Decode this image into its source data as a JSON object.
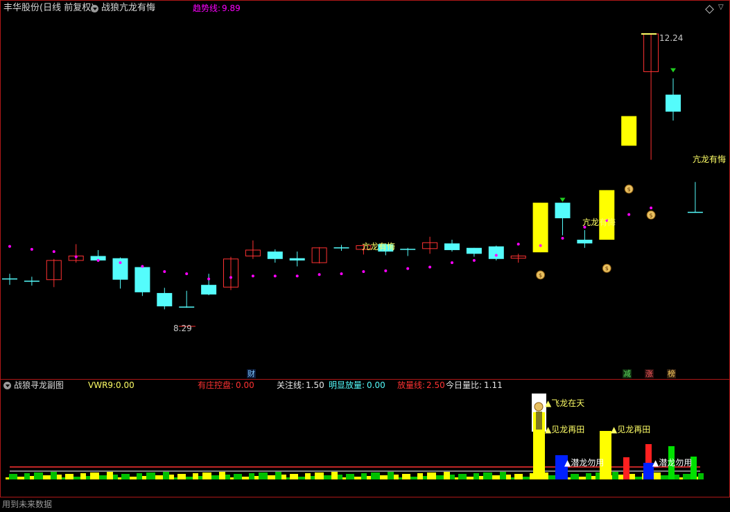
{
  "main_panel": {
    "title": "丰华股份(日线 前复权)",
    "indicator_name": "战狼亢龙有悔",
    "trend_label": "趋势线:",
    "trend_value": "9.89",
    "high_label": "12.24",
    "low_label": "8.29",
    "annotations": [
      "亢龙有悔",
      "亢龙有悔",
      "亢龙有悔"
    ],
    "bottom_markers": {
      "cai": "财",
      "jian": "减",
      "zhang": "涨",
      "bang": "榜"
    }
  },
  "sub_panel": {
    "title": "战狼寻龙副图",
    "vwr_label": "VWR9:",
    "vwr_value": "0.00",
    "youzhuang_label": "有庄控盘:",
    "youzhuang_value": "0.00",
    "guanzhu_label": "关注线:",
    "guanzhu_value": "1.50",
    "mingxian_label": "明显放量:",
    "mingxian_value": "0.00",
    "fangliang_label": "放量线:",
    "fangliang_value": "2.50",
    "jinri_label": "今日量比:",
    "jinri_value": "1.11",
    "signals": [
      "飞龙在天",
      "见龙再田",
      "见龙再田",
      "潜龙勿用",
      "潜龙勿用"
    ]
  },
  "footer": {
    "notice": "用到未来数据"
  },
  "colors": {
    "border": "#b01818",
    "bear": "#54fcfc",
    "bull": "#ff3232",
    "signal": "#ffff00",
    "trend": "#ff00ff"
  },
  "candles": [
    {
      "o": 8.93,
      "c": 8.93,
      "h": 9.0,
      "l": 8.85
    },
    {
      "o": 8.9,
      "c": 8.9,
      "h": 8.96,
      "l": 8.84
    },
    {
      "o": 8.92,
      "c": 9.18,
      "h": 9.2,
      "l": 8.82
    },
    {
      "o": 9.18,
      "c": 9.24,
      "h": 9.4,
      "l": 9.15
    },
    {
      "o": 9.24,
      "c": 9.18,
      "h": 9.32,
      "l": 9.16
    },
    {
      "o": 9.21,
      "c": 8.92,
      "h": 9.22,
      "l": 8.8
    },
    {
      "o": 9.09,
      "c": 8.75,
      "h": 9.1,
      "l": 8.7
    },
    {
      "o": 8.74,
      "c": 8.56,
      "h": 8.81,
      "l": 8.52
    },
    {
      "o": 8.55,
      "c": 8.55,
      "h": 8.77,
      "l": 8.54
    },
    {
      "o": 8.85,
      "c": 8.72,
      "h": 9.0,
      "l": 8.71
    },
    {
      "o": 8.82,
      "c": 9.2,
      "h": 9.23,
      "l": 8.78
    },
    {
      "o": 9.24,
      "c": 9.32,
      "h": 9.45,
      "l": 9.2
    },
    {
      "o": 9.3,
      "c": 9.2,
      "h": 9.33,
      "l": 9.15
    },
    {
      "o": 9.21,
      "c": 9.18,
      "h": 9.3,
      "l": 9.1
    },
    {
      "o": 9.15,
      "c": 9.35,
      "h": 9.36,
      "l": 9.14
    },
    {
      "o": 9.35,
      "c": 9.35,
      "h": 9.39,
      "l": 9.31
    },
    {
      "o": 9.33,
      "c": 9.38,
      "h": 9.4,
      "l": 9.26
    },
    {
      "o": 9.4,
      "c": 9.3,
      "h": 9.41,
      "l": 9.25
    },
    {
      "o": 9.33,
      "c": 9.33,
      "h": 9.35,
      "l": 9.24
    },
    {
      "o": 9.34,
      "c": 9.42,
      "h": 9.5,
      "l": 9.27
    },
    {
      "o": 9.41,
      "c": 9.32,
      "h": 9.46,
      "l": 9.3
    },
    {
      "o": 9.35,
      "c": 9.27,
      "h": 9.35,
      "l": 9.23
    },
    {
      "o": 9.37,
      "c": 9.2,
      "h": 9.38,
      "l": 9.18
    },
    {
      "o": 9.21,
      "c": 9.24,
      "h": 9.27,
      "l": 9.15
    },
    {
      "o": 9.29,
      "c": 9.96,
      "h": 9.96,
      "l": 9.29
    },
    {
      "o": 9.96,
      "c": 9.75,
      "h": 9.96,
      "l": 9.52
    },
    {
      "o": 9.46,
      "c": 9.41,
      "h": 9.59,
      "l": 9.35
    },
    {
      "o": 9.46,
      "c": 10.13,
      "h": 10.13,
      "l": 9.46
    },
    {
      "o": 10.73,
      "c": 11.13,
      "h": 11.13,
      "l": 10.73
    },
    {
      "o": 11.73,
      "c": 12.24,
      "h": 12.24,
      "l": 10.54
    },
    {
      "o": 11.42,
      "c": 11.19,
      "h": 11.64,
      "l": 11.07
    },
    {
      "o": 9.83,
      "c": 9.83,
      "h": 10.24,
      "l": 9.83
    }
  ],
  "yellow_candles": [
    24,
    27,
    28
  ],
  "trend_dots": [
    9.37,
    9.33,
    9.3,
    9.23,
    9.18,
    9.15,
    9.1,
    9.03,
    9.0,
    8.93,
    8.95,
    8.97,
    8.97,
    8.97,
    8.99,
    9.0,
    9.03,
    9.04,
    9.07,
    9.09,
    9.15,
    9.18,
    9.25,
    9.4,
    9.38,
    9.48,
    9.63,
    9.72,
    9.8,
    9.89
  ]
}
